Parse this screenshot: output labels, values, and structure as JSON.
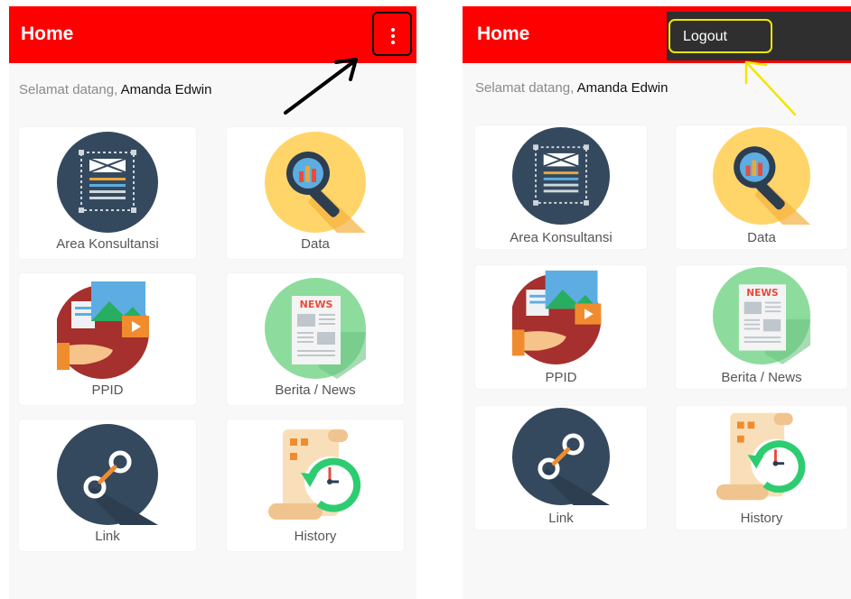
{
  "left": {
    "appbar": {
      "title": "Home"
    },
    "greeting": {
      "prefix": "Selamat datang,",
      "name": "Amanda Edwin"
    },
    "tiles": [
      {
        "label": "Area Konsultansi",
        "icon": "area-konsultansi-icon"
      },
      {
        "label": "Data",
        "icon": "data-magnifier-icon"
      },
      {
        "label": "PPID",
        "icon": "ppid-media-icon"
      },
      {
        "label": "Berita / News",
        "icon": "news-icon"
      },
      {
        "label": "Link",
        "icon": "link-icon"
      },
      {
        "label": "History",
        "icon": "history-icon"
      }
    ],
    "overflow_icon": "kebab-menu-icon"
  },
  "right": {
    "appbar": {
      "title": "Home"
    },
    "greeting": {
      "prefix": "Selamat datang,",
      "name": "Amanda Edwin"
    },
    "menu": {
      "logout_label": "Logout"
    },
    "tiles": [
      {
        "label": "Area Konsultansi",
        "icon": "area-konsultansi-icon"
      },
      {
        "label": "Data",
        "icon": "data-magnifier-icon"
      },
      {
        "label": "PPID",
        "icon": "ppid-media-icon"
      },
      {
        "label": "Berita / News",
        "icon": "news-icon"
      },
      {
        "label": "Link",
        "icon": "link-icon"
      },
      {
        "label": "History",
        "icon": "history-icon"
      }
    ]
  },
  "colors": {
    "appbar": "#ff0000",
    "highlight_box": "#111111",
    "annotation_arrow_left": "#000000",
    "annotation_yellow": "#f2e600",
    "menu_bg": "#2f2f2f"
  },
  "icon_text": {
    "news_badge": "NEWS"
  }
}
